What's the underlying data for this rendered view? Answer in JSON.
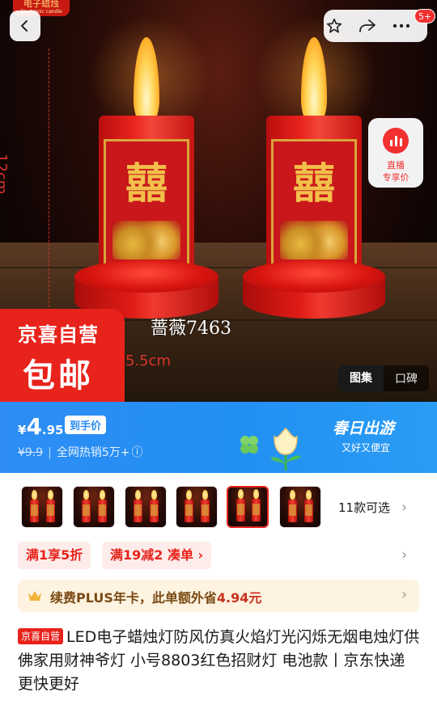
{
  "hero": {
    "brand_tag": "电子蜡烛",
    "brand_tag_en": "Electronic candle",
    "measure_height": "12cm",
    "measure_width": "5.5cm",
    "watermark": "蔷薇7463",
    "candle_glyph": "囍",
    "promo_badge_line1": "京喜自营",
    "promo_badge_line2": "包邮",
    "notification_count": "5+",
    "live_card": {
      "line1": "直播",
      "line2": "专享价"
    },
    "gallery_tabs": [
      "图集",
      "口碑"
    ]
  },
  "price": {
    "currency": "¥",
    "integer": "4",
    "decimal": ".95",
    "hand_price_label": "到手价",
    "original_price": "¥9.9",
    "sales_text": "全网热销5万+",
    "info_icon": "ⓘ",
    "promo_title": "春日出游",
    "promo_subtitle": "又好又便宜"
  },
  "variants": {
    "count_text": "11款可选",
    "selected_index": 4
  },
  "coupons": [
    {
      "label": "满1享5折"
    },
    {
      "label": "满19减2  凑单 ›"
    }
  ],
  "plus": {
    "text": "续费PLUS年卡，此单额外省",
    "amount": "4.94元"
  },
  "product": {
    "store_tag": "京喜自营",
    "title": "LED电子蜡烛灯防风仿真火焰灯光闪烁无烟电烛灯供佛家用财神爷灯 小号8803红色招财灯 电池款丨京东快递 更快更好"
  },
  "colors": {
    "accent_red": "#e8231c",
    "price_band_blue": "#2290f2",
    "plus_gold": "#7a4a14"
  }
}
